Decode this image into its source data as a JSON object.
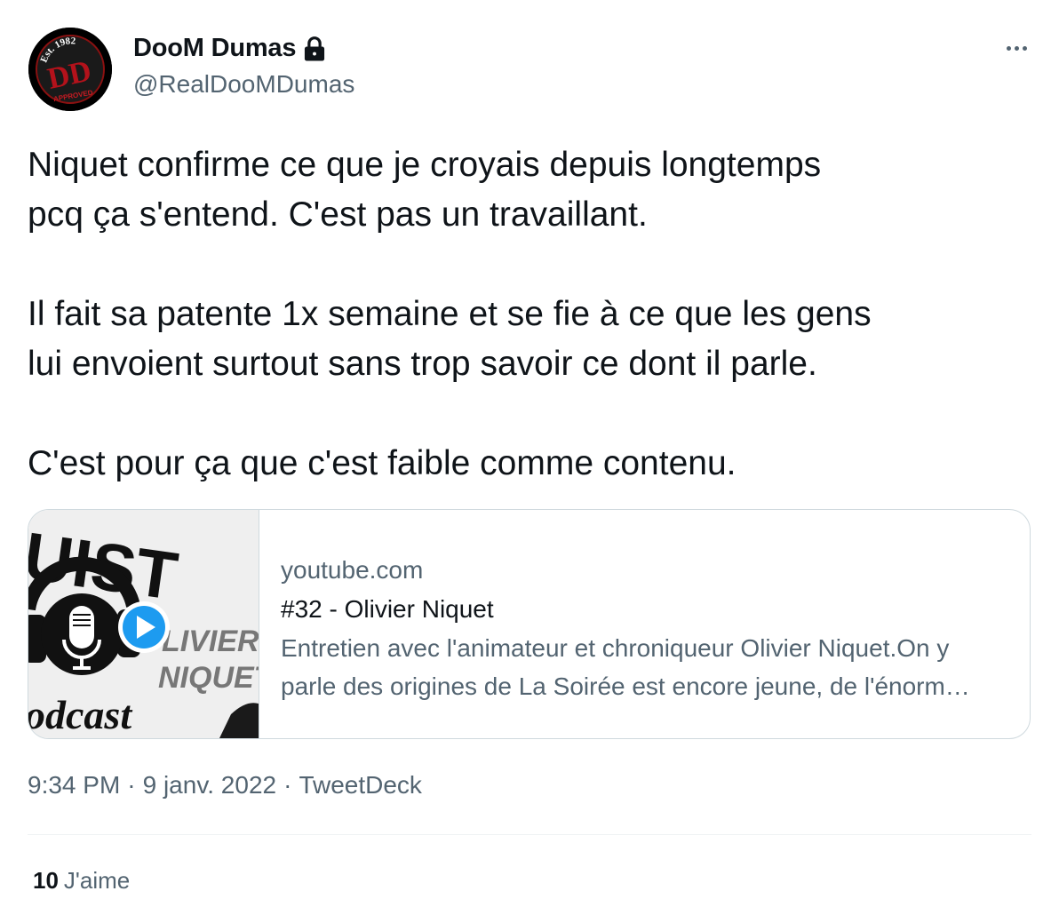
{
  "author": {
    "display_name": "DooM Dumas",
    "handle": "@RealDooMDumas",
    "avatar": {
      "arc_text": "Est. 1982",
      "monogram": "DD",
      "stamp_text": "APPROVED"
    }
  },
  "tweet": {
    "paragraphs": [
      [
        "Niquet confirme ce que je croyais depuis longtemps",
        "pcq ça s'entend. C'est pas un travaillant."
      ],
      [
        "Il fait sa patente 1x semaine et se fie à ce que les gens",
        "lui envoient surtout sans trop savoir ce dont il parle."
      ],
      [
        "C'est pour ça que c'est faible comme contenu."
      ]
    ]
  },
  "card": {
    "domain": "youtube.com",
    "title": "#32 - Olivier Niquet",
    "description": "Entretien avec l'animateur et chroniqueur Olivier Niquet.On y\nparle des origines de La Soirée est encore jeune, de l'énorm…",
    "thumbnail": {
      "word_top": "UIST",
      "name_line1": "LIVIER",
      "name_line2": "NIQUET",
      "word_bottom": "odcast"
    }
  },
  "meta": {
    "time": "9:34 PM",
    "date": "9 janv. 2022",
    "separator": "·",
    "source": "TweetDeck"
  },
  "stats": {
    "likes_count": "10",
    "likes_label": "J'aime"
  },
  "colors": {
    "text_primary": "#0f1419",
    "text_secondary": "#536471",
    "border": "#cfd9de",
    "play_button": "#1d9bf0"
  },
  "icons": {
    "lock": "lock-icon",
    "more": "more-icon",
    "play": "play-icon"
  }
}
